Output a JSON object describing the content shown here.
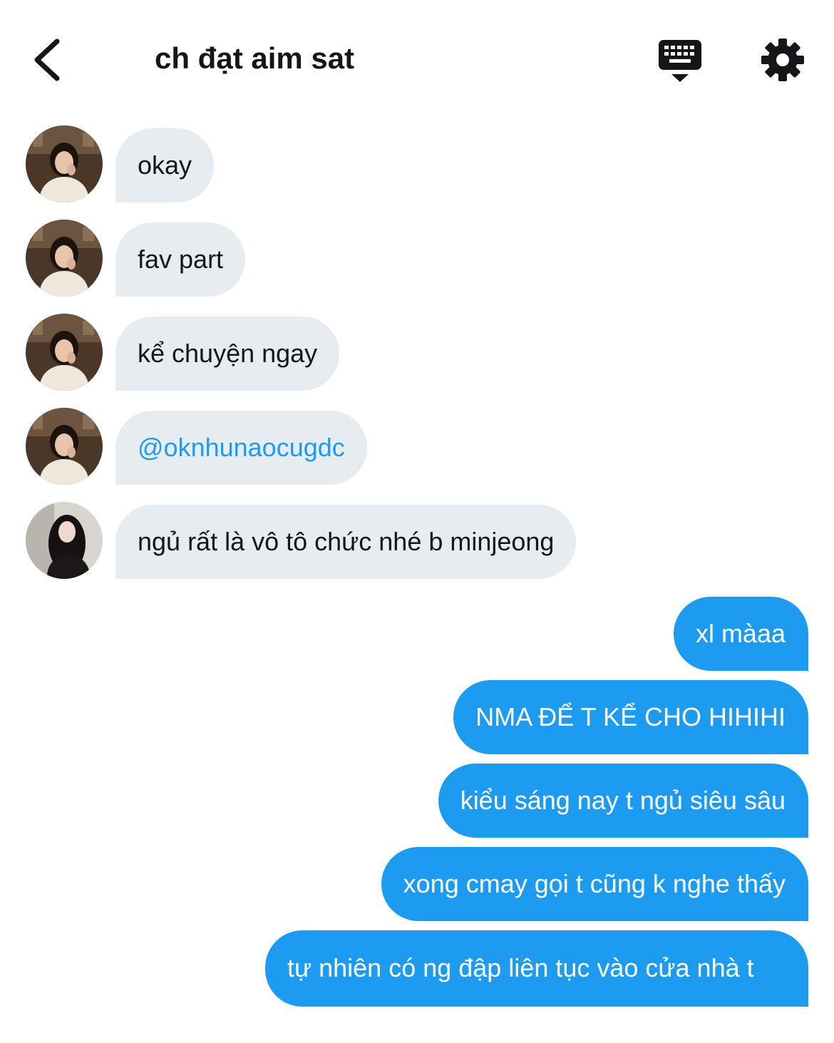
{
  "header": {
    "title": "ch đạt aim sat",
    "back_icon": "chevron-left-icon",
    "keyboard_icon": "keyboard-hide-icon",
    "settings_icon": "gear-icon"
  },
  "messages": [
    {
      "direction": "incoming",
      "text": "okay"
    },
    {
      "direction": "incoming",
      "text": "fav part"
    },
    {
      "direction": "incoming",
      "text": "kể chuyện ngay"
    },
    {
      "direction": "incoming",
      "text": "@oknhunaocugdc",
      "is_mention": true
    },
    {
      "direction": "incoming",
      "text": "ngủ rất là vô tô chức nhé b minjeong"
    },
    {
      "direction": "outgoing",
      "text": "xl màaa"
    },
    {
      "direction": "outgoing",
      "text": "NMA ĐỂ T KỂ CHO HIHIHI"
    },
    {
      "direction": "outgoing",
      "text": "kiểu sáng nay t ngủ siêu sâu"
    },
    {
      "direction": "outgoing",
      "text": "xong cmay gọi t cũng k nghe thấy"
    },
    {
      "direction": "outgoing",
      "text": "tự nhiên có ng đập liên tục vào cửa nhà t"
    }
  ],
  "colors": {
    "incoming_bubble": "#e6ecf0",
    "outgoing_bubble": "#1d9bf0",
    "mention": "#1d9bf0",
    "text": "#14171a"
  }
}
